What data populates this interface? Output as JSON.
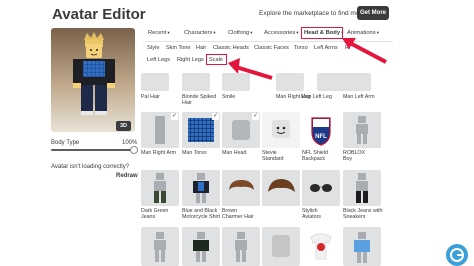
{
  "header": {
    "title": "Avatar Editor",
    "promo": "Explore the marketplace to find more clothes!",
    "get_more": "Get More"
  },
  "preview": {
    "btn_3d": "3D",
    "body_type_label": "Body Type",
    "body_type_value": "100%",
    "body_type_level": 1.0,
    "loading_text": "Avatar isn't loading correctly?",
    "redraw": "Redraw"
  },
  "tabs": [
    {
      "label": "Recent",
      "active": false
    },
    {
      "label": "Characters",
      "active": false
    },
    {
      "label": "Clothing",
      "active": false
    },
    {
      "label": "Accessories",
      "active": false
    },
    {
      "label": "Head & Body",
      "active": true
    },
    {
      "label": "Animations",
      "active": false
    }
  ],
  "subtabs": [
    "Style",
    "Skin Tone",
    "Hair",
    "Classic Heads",
    "Classic Faces",
    "Torso",
    "Left Arms",
    "Ri",
    "Left Legs",
    "Right Legs",
    "Scale"
  ],
  "grid": {
    "row1_captions": [
      "Pal Hair",
      "Blonde Spiked Hair",
      "Smile",
      "Man Right Leg",
      "Man Left Leg",
      "Man Left Arm"
    ],
    "row2_captions": [
      "Man Right Arm",
      "Man Torso",
      "Man Head",
      "Stevie Standard",
      "NFL Shield Backpack",
      "ROBLOX Boy"
    ],
    "row3_captions": [
      "Dark Green Jeans",
      "Blue and Black Motorcycle Shirt",
      "Brown Charmer Hair",
      "",
      "Stylish Aviators",
      "Black Jeans with Sneakers"
    ]
  },
  "colors": {
    "highlight": "#e3173e",
    "tile_bg": "#dfe1e3",
    "dark_button": "#393b3d",
    "blue_item": "#2f6fc4"
  }
}
